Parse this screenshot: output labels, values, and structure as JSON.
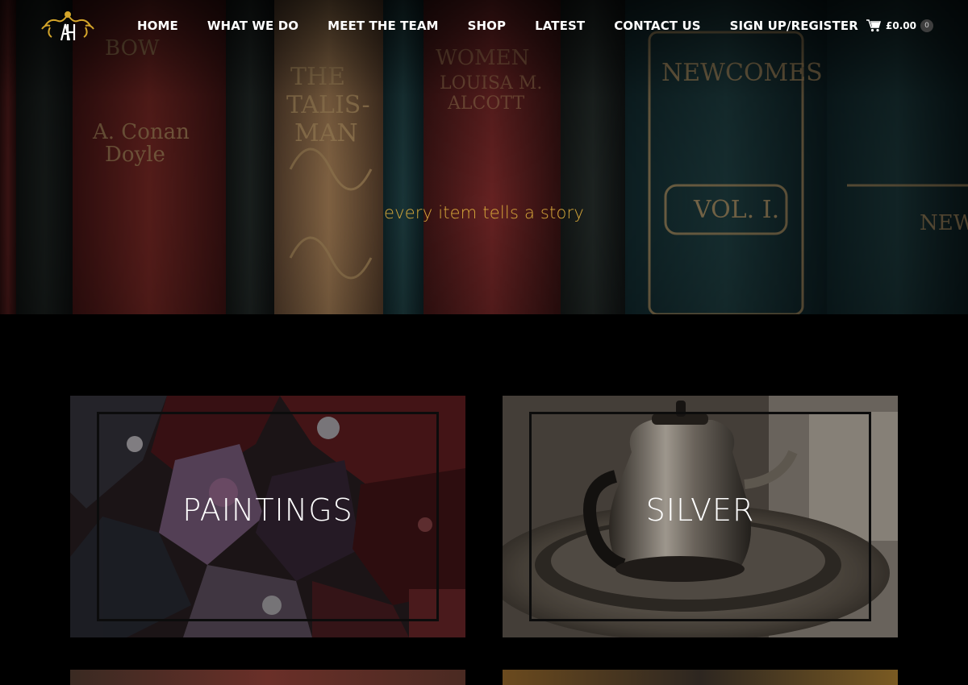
{
  "brand": {
    "logo_icon": "ornate-crown-monogram-icon",
    "accent": "#d4a52a"
  },
  "nav": {
    "items": [
      {
        "label": "HOME"
      },
      {
        "label": "WHAT WE DO"
      },
      {
        "label": "MEET THE TEAM"
      },
      {
        "label": "SHOP"
      },
      {
        "label": "LATEST"
      },
      {
        "label": "CONTACT US"
      },
      {
        "label": "SIGN UP/REGISTER"
      }
    ]
  },
  "cart": {
    "icon": "shopping-cart-icon",
    "total": "£0.00",
    "count": "0"
  },
  "hero": {
    "tagline": "every item tells a story",
    "tagline_color": "#d7a83a"
  },
  "categories": [
    {
      "label": "PAINTINGS"
    },
    {
      "label": "SILVER"
    }
  ]
}
